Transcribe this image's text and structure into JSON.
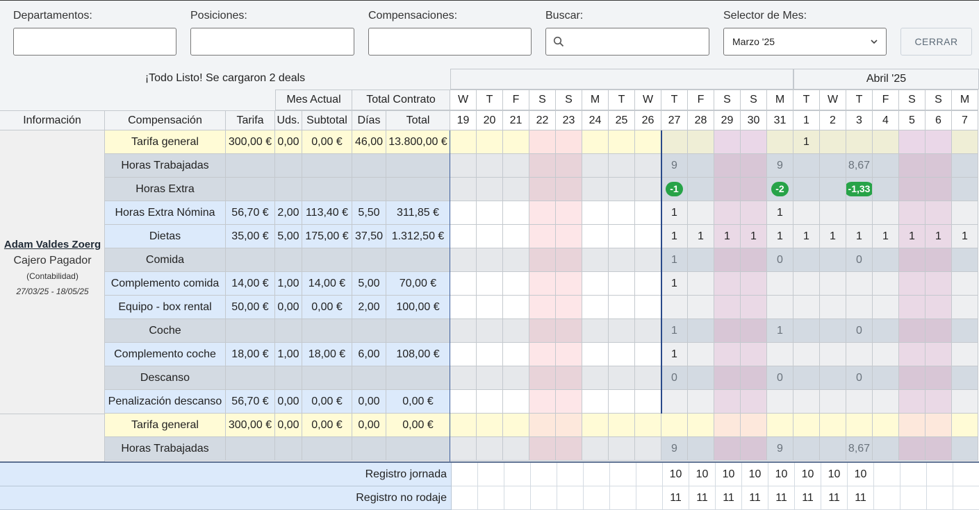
{
  "filters": {
    "departamentos": {
      "label": "Departamentos:",
      "value": ""
    },
    "posiciones": {
      "label": "Posiciones:",
      "value": ""
    },
    "compensaciones": {
      "label": "Compensaciones:",
      "value": ""
    },
    "buscar": {
      "label": "Buscar:",
      "value": ""
    },
    "mes": {
      "label": "Selector de Mes:",
      "value": "Marzo '25"
    },
    "close_label": "CERRAR"
  },
  "status": "¡Todo Listo! Se cargaron 2 deals",
  "april_label": "Abril '25",
  "group_headers": {
    "mes_actual": "Mes Actual",
    "total_contrato": "Total Contrato"
  },
  "col_headers": {
    "informacion": "Información",
    "compensacion": "Compensación",
    "tarifa": "Tarifa",
    "uds": "Uds.",
    "subtotal": "Subtotal",
    "dias": "Días",
    "total": "Total"
  },
  "days": [
    {
      "l": "W",
      "n": "19",
      "t": "wd"
    },
    {
      "l": "T",
      "n": "20",
      "t": "wd"
    },
    {
      "l": "F",
      "n": "21",
      "t": "wd"
    },
    {
      "l": "S",
      "n": "22",
      "t": "we"
    },
    {
      "l": "S",
      "n": "23",
      "t": "we"
    },
    {
      "l": "M",
      "n": "24",
      "t": "wd"
    },
    {
      "l": "T",
      "n": "25",
      "t": "wd"
    },
    {
      "l": "W",
      "n": "26",
      "t": "wd"
    },
    {
      "l": "T",
      "n": "27",
      "t": "wd"
    },
    {
      "l": "F",
      "n": "28",
      "t": "wd"
    },
    {
      "l": "S",
      "n": "29",
      "t": "we"
    },
    {
      "l": "S",
      "n": "30",
      "t": "we"
    },
    {
      "l": "M",
      "n": "31",
      "t": "wd"
    },
    {
      "l": "T",
      "n": "1",
      "t": "wd"
    },
    {
      "l": "W",
      "n": "2",
      "t": "wd"
    },
    {
      "l": "T",
      "n": "3",
      "t": "wd"
    },
    {
      "l": "F",
      "n": "4",
      "t": "wd"
    },
    {
      "l": "S",
      "n": "5",
      "t": "we"
    },
    {
      "l": "S",
      "n": "6",
      "t": "we"
    },
    {
      "l": "M",
      "n": "7",
      "t": "wd"
    }
  ],
  "person": {
    "name": "Adam Valdes Zoerg",
    "role": "Cajero Pagador",
    "dept": "(Contabilidad)",
    "dates": "27/03/25 - 18/05/25"
  },
  "rows": [
    {
      "name": "Tarifa general",
      "type": "yellow",
      "tarifa": "300,00 €",
      "uds": "0,00",
      "subtotal": "0,00 €",
      "dias": "46,00",
      "total": "13.800,00 €",
      "vals": {
        "13": "1"
      }
    },
    {
      "name": "Horas Trabajadas",
      "type": "gray",
      "vals": {
        "8": "9",
        "12": "9",
        "15": "8,67"
      }
    },
    {
      "name": "Horas Extra",
      "type": "gray",
      "pills": {
        "8": "-1",
        "12": "-2",
        "15": "-1,33"
      }
    },
    {
      "name": "Horas Extra Nómina",
      "type": "blue",
      "tarifa": "56,70 €",
      "uds": "2,00",
      "subtotal": "113,40 €",
      "dias": "5,50",
      "total": "311,85 €",
      "vals": {
        "8": "1",
        "12": "1"
      }
    },
    {
      "name": "Dietas",
      "type": "blue",
      "tarifa": "35,00 €",
      "uds": "5,00",
      "subtotal": "175,00 €",
      "dias": "37,50",
      "total": "1.312,50 €",
      "vals": {
        "8": "1",
        "9": "1",
        "10": "1",
        "11": "1",
        "12": "1",
        "13": "1",
        "14": "1",
        "15": "1",
        "16": "1",
        "17": "1",
        "18": "1",
        "19": "1"
      }
    },
    {
      "name": "Comida",
      "type": "gray",
      "vals": {
        "8": "1",
        "12": "0",
        "15": "0"
      }
    },
    {
      "name": "Complemento comida",
      "type": "blue",
      "tarifa": "14,00 €",
      "uds": "1,00",
      "subtotal": "14,00 €",
      "dias": "5,00",
      "total": "70,00 €",
      "vals": {
        "8": "1"
      }
    },
    {
      "name": "Equipo - box rental",
      "type": "blue",
      "tarifa": "50,00 €",
      "uds": "0,00",
      "subtotal": "0,00 €",
      "dias": "2,00",
      "total": "100,00 €",
      "vals": {}
    },
    {
      "name": "Coche",
      "type": "gray",
      "vals": {
        "8": "1",
        "12": "1",
        "15": "0"
      }
    },
    {
      "name": "Complemento coche",
      "type": "blue",
      "tarifa": "18,00 €",
      "uds": "1,00",
      "subtotal": "18,00 €",
      "dias": "6,00",
      "total": "108,00 €",
      "vals": {
        "8": "1"
      }
    },
    {
      "name": "Descanso",
      "type": "gray",
      "vals": {
        "8": "0",
        "12": "0",
        "15": "0"
      }
    },
    {
      "name": "Penalización descanso",
      "type": "blue",
      "tarifa": "56,70 €",
      "uds": "0,00",
      "subtotal": "0,00 €",
      "dias": "0,00",
      "total": "0,00 €",
      "vals": {}
    },
    {
      "name": "Tarifa general",
      "type": "yellow2",
      "tarifa": "300,00 €",
      "uds": "0,00",
      "subtotal": "0,00 €",
      "dias": "0,00",
      "total": "0,00 €",
      "vals": {}
    },
    {
      "name": "Horas Trabajadas",
      "type": "gray2",
      "vals": {
        "8": "9",
        "12": "9",
        "15": "8,67"
      }
    }
  ],
  "footer": [
    {
      "label": "Registro jornada",
      "vals": {
        "8": "10",
        "9": "10",
        "10": "10",
        "11": "10",
        "12": "10",
        "13": "10",
        "14": "10",
        "15": "10"
      }
    },
    {
      "label": "Registro no rodaje",
      "vals": {
        "8": "11",
        "9": "11",
        "10": "11",
        "11": "11",
        "12": "11",
        "13": "11",
        "14": "11",
        "15": "11"
      }
    }
  ],
  "colors": {
    "yellow": "#fffbd6",
    "blue": "#dceafb",
    "gray": "#d3dae2",
    "weekend_pink": "#fde6e8",
    "header_bg": "#f2f4f6",
    "pill": "#27a348",
    "marker": "#2a4a8a"
  }
}
